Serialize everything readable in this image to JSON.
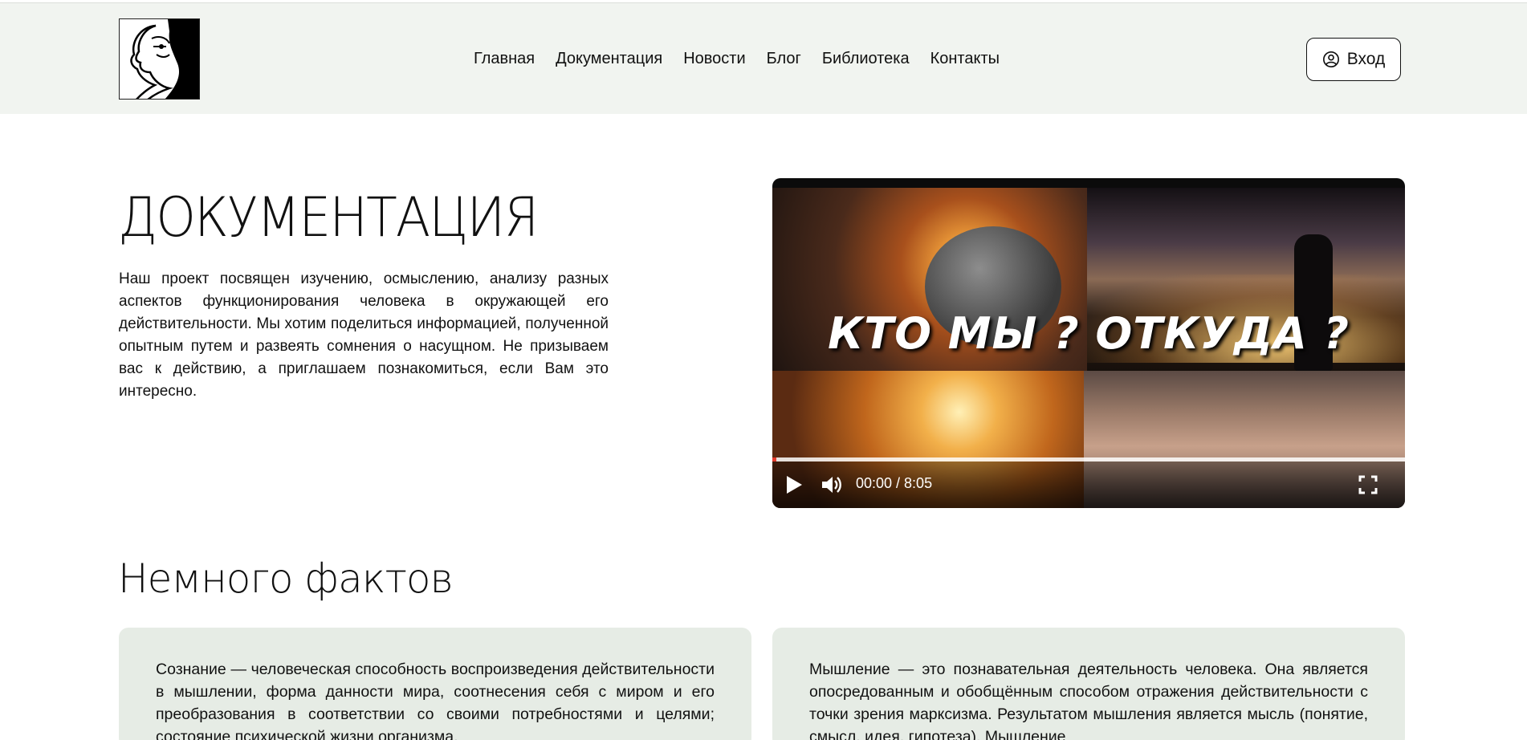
{
  "header": {
    "logo": "logo-face",
    "nav": [
      {
        "label": "Главная"
      },
      {
        "label": "Документация"
      },
      {
        "label": "Новости"
      },
      {
        "label": "Блог"
      },
      {
        "label": "Библиотека"
      },
      {
        "label": "Контакты"
      }
    ],
    "login": {
      "label": "Вход",
      "icon": "user-circle-icon"
    }
  },
  "hero": {
    "title": "ДОКУМЕНТАЦИЯ",
    "intro": "Наш проект посвящен изучению, осмыслению, анализу разных аспектов функционирования человека в окружающей его действительности. Мы хотим поделиться информацией, полученной опытным путем и развеять сомнения о насущном. Не призываем вас к действию, а приглашаем познакомиться, если Вам это интересно."
  },
  "video": {
    "overlay_text": "КТО МЫ ?  ОТКУДА ?",
    "time": "00:00 / 8:05",
    "progress_fraction": 0.0,
    "icons": [
      "play-icon",
      "volume-icon",
      "fullscreen-icon"
    ]
  },
  "facts": {
    "title": "Немного фактов",
    "cards": [
      {
        "text": "Сознание — человеческая способность воспроизведения действительности в мышлении, форма данности мира, соотнесения себя с миром и его преобразования в соответствии со своими потребностями и целями; состояние психической жизни организма,"
      },
      {
        "text": "Мышление — это познавательная деятельность человека. Она является опосредованным и обобщённым способом отражения действительности с точки зрения марксизма. Результатом мышления является мысль (понятие, смысл, идея, гипотеза). Мышление"
      }
    ]
  },
  "colors": {
    "header_bg": "#f1f4f0",
    "card_bg": "#e6ece5",
    "progress": "#e53b2c"
  }
}
